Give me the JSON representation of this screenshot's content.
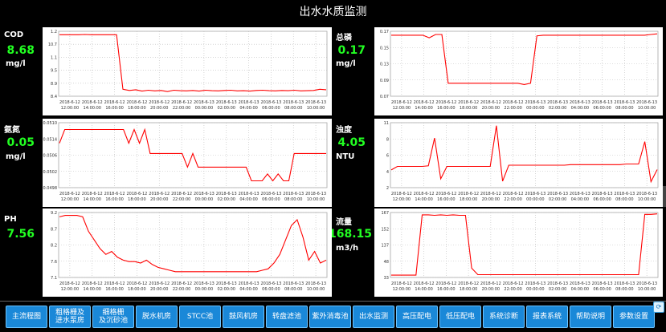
{
  "page": {
    "title": "出水水质监测"
  },
  "params": [
    {
      "name": "COD",
      "value": "8.68",
      "unit": "mg/l"
    },
    {
      "name": "总磷",
      "value": "0.17",
      "unit": "mg/l"
    },
    {
      "name": "氨氮",
      "value": "0.05",
      "unit": "mg/l"
    },
    {
      "name": "浊度",
      "value": "4.05",
      "unit": "NTU"
    },
    {
      "name": "PH",
      "value": "7.56",
      "unit": ""
    },
    {
      "name": "流量",
      "value": "168.15",
      "unit": "m3/h"
    }
  ],
  "nav": {
    "buttons": [
      "主流程图",
      "粗格栅及\n进水泵房",
      "细格栅\n及沉砂池",
      "脱水机房",
      "STCC池",
      "鼓风机房",
      "转盘滤池",
      "紫外消毒池",
      "出水监测",
      "高压配电",
      "低压配电",
      "系统诊断",
      "报表系统",
      "帮助说明",
      "参数设置"
    ]
  },
  "chart_data": [
    {
      "type": "line",
      "title": "COD",
      "color": "#ff0000",
      "x": [
        "2018-6-12 12:00:00",
        "2018-6-12 14:00:00",
        "2018-6-12 16:00:00",
        "2018-6-12 18:00:00",
        "2018-6-12 20:00:00",
        "2018-6-12 22:00:00",
        "2018-6-13 00:00:00",
        "2018-6-13 02:00:00",
        "2018-6-13 04:00:00",
        "2018-6-13 06:00:00",
        "2018-6-13 08:00:00",
        "2018-6-13 10:00:00"
      ],
      "yticks": [
        "1.2",
        "10.7",
        "1.1",
        "9.5",
        "8.9",
        "8.4"
      ],
      "ylim": [
        8.4,
        11.2
      ],
      "series": [
        {
          "values": [
            11.05,
            11.05,
            11.05,
            11.05,
            11.06,
            11.05,
            11.05,
            11.05,
            11.05,
            11.05,
            8.7,
            8.65,
            8.68,
            8.62,
            8.66,
            8.63,
            8.65,
            8.6,
            8.66,
            8.64,
            8.63,
            8.65,
            8.62,
            8.66,
            8.64,
            8.63,
            8.65,
            8.66,
            8.63,
            8.64,
            8.62,
            8.65,
            8.66,
            8.64,
            8.63,
            8.65,
            8.64,
            8.66,
            8.63,
            8.64,
            8.65,
            8.7,
            8.68
          ]
        }
      ]
    },
    {
      "type": "line",
      "title": "总磷",
      "color": "#ff0000",
      "x": [
        "2018-6-12 12:00:00",
        "2018-6-12 14:00:00",
        "2018-6-12 16:00:00",
        "2018-6-12 18:00:00",
        "2018-6-12 20:00:00",
        "2018-6-12 22:00:00",
        "2018-6-13 00:00:00",
        "2018-6-13 02:00:00",
        "2018-6-13 04:00:00",
        "2018-6-13 06:00:00",
        "2018-6-13 08:00:00",
        "2018-6-13 10:00:00"
      ],
      "yticks": [
        "0.17",
        "0.15",
        "0.13",
        "0.09",
        "0.07"
      ],
      "ylim": [
        0.07,
        0.17
      ],
      "series": [
        {
          "values": [
            0.164,
            0.164,
            0.164,
            0.164,
            0.164,
            0.164,
            0.16,
            0.165,
            0.165,
            0.09,
            0.09,
            0.09,
            0.09,
            0.09,
            0.09,
            0.09,
            0.09,
            0.09,
            0.09,
            0.09,
            0.09,
            0.088,
            0.09,
            0.163,
            0.164,
            0.164,
            0.164,
            0.164,
            0.164,
            0.164,
            0.164,
            0.164,
            0.164,
            0.164,
            0.164,
            0.164,
            0.164,
            0.164,
            0.164,
            0.164,
            0.164,
            0.165,
            0.166
          ]
        }
      ]
    },
    {
      "type": "line",
      "title": "氨氮",
      "color": "#ff0000",
      "x": [
        "2018-6-12 12:00:00",
        "2018-6-12 14:00:00",
        "2018-6-12 16:00:00",
        "2018-6-12 18:00:00",
        "2018-6-12 20:00:00",
        "2018-6-12 22:00:00",
        "2018-6-13 00:00:00",
        "2018-6-13 02:00:00",
        "2018-6-13 04:00:00",
        "2018-6-13 06:00:00",
        "2018-6-13 08:00:00",
        "2018-6-13 10:00:00"
      ],
      "yticks": [
        "0.0510",
        "0.0514",
        "0.0506",
        "0.0502",
        "0.0498"
      ],
      "ylim": [
        0.0497,
        0.0516
      ],
      "series": [
        {
          "values": [
            0.051,
            0.0514,
            0.0514,
            0.0514,
            0.0514,
            0.0514,
            0.0514,
            0.0514,
            0.0514,
            0.0514,
            0.0514,
            0.0514,
            0.0514,
            0.051,
            0.0514,
            0.051,
            0.0514,
            0.0507,
            0.0507,
            0.0507,
            0.0507,
            0.0507,
            0.0507,
            0.0507,
            0.0503,
            0.0507,
            0.0503,
            0.0503,
            0.0503,
            0.0503,
            0.0503,
            0.0503,
            0.0503,
            0.0503,
            0.0503,
            0.0503,
            0.0499,
            0.0499,
            0.0499,
            0.0501,
            0.0499,
            0.0501,
            0.0499,
            0.0499,
            0.0507,
            0.0507,
            0.0507,
            0.0507,
            0.0507,
            0.0507,
            0.0507
          ]
        }
      ]
    },
    {
      "type": "line",
      "title": "浊度",
      "color": "#ff0000",
      "x": [
        "2018-6-12 12:00:00",
        "2018-6-12 14:00:00",
        "2018-6-12 16:00:00",
        "2018-6-12 18:00:00",
        "2018-6-12 20:00:00",
        "2018-6-12 22:00:00",
        "2018-6-13 00:00:00",
        "2018-6-13 02:00:00",
        "2018-6-13 04:00:00",
        "2018-6-13 06:00:00",
        "2018-6-13 08:00:00",
        "2018-6-13 10:00:00"
      ],
      "yticks": [
        "11",
        "8",
        "6",
        "4",
        "2"
      ],
      "ylim": [
        1,
        12
      ],
      "series": [
        {
          "values": [
            4,
            4.6,
            4.6,
            4.6,
            4.6,
            4.6,
            4.7,
            9.4,
            2.5,
            4.6,
            4.6,
            4.6,
            4.6,
            4.6,
            4.6,
            4.6,
            4.6,
            11.5,
            2.1,
            4.8,
            4.8,
            4.8,
            4.8,
            4.8,
            4.8,
            4.8,
            4.8,
            4.8,
            4.8,
            4.9,
            4.9,
            4.9,
            4.9,
            4.9,
            4.9,
            4.9,
            4.9,
            4.9,
            5,
            5,
            5,
            8.8,
            2,
            4.05
          ]
        }
      ]
    },
    {
      "type": "line",
      "title": "PH",
      "color": "#ff0000",
      "x": [
        "2018-6-12 12:00:00",
        "2018-6-12 14:00:00",
        "2018-6-12 16:00:00",
        "2018-6-12 18:00:00",
        "2018-6-12 20:00:00",
        "2018-6-12 22:00:00",
        "2018-6-13 00:00:00",
        "2018-6-13 02:00:00",
        "2018-6-13 04:00:00",
        "2018-6-13 06:00:00",
        "2018-6-13 08:00:00",
        "2018-6-13 10:00:00"
      ],
      "yticks": [
        "9.2",
        "8.7",
        "8.2",
        "7.6",
        "7.1"
      ],
      "ylim": [
        7.0,
        9.25
      ],
      "series": [
        {
          "values": [
            9.1,
            9.15,
            9.15,
            9.15,
            9.1,
            8.6,
            8.3,
            8.0,
            7.8,
            7.9,
            7.7,
            7.6,
            7.55,
            7.55,
            7.5,
            7.6,
            7.45,
            7.35,
            7.3,
            7.25,
            7.2,
            7.2,
            7.2,
            7.2,
            7.2,
            7.2,
            7.2,
            7.2,
            7.2,
            7.2,
            7.2,
            7.2,
            7.2,
            7.2,
            7.2,
            7.25,
            7.3,
            7.5,
            7.8,
            8.3,
            8.8,
            9.0,
            8.4,
            7.6,
            7.9,
            7.5,
            7.6
          ]
        }
      ]
    },
    {
      "type": "line",
      "title": "流量",
      "color": "#ff0000",
      "x": [
        "2018-6-12 12:00:00",
        "2018-6-12 14:00:00",
        "2018-6-12 16:00:00",
        "2018-6-12 18:00:00",
        "2018-6-12 20:00:00",
        "2018-6-12 22:00:00",
        "2018-6-13 00:00:00",
        "2018-6-13 02:00:00",
        "2018-6-13 04:00:00",
        "2018-6-13 06:00:00",
        "2018-6-13 08:00:00",
        "2018-6-13 10:00:00"
      ],
      "yticks": [
        "167",
        "152",
        "137",
        "48",
        "33"
      ],
      "ylim": [
        30,
        170
      ],
      "series": [
        {
          "values": [
            35,
            35,
            35,
            35,
            35,
            165,
            165,
            164,
            165,
            164,
            165,
            164,
            164,
            50,
            36,
            36,
            36,
            36,
            36,
            36,
            36,
            36,
            36,
            36,
            36,
            36,
            36,
            36,
            36,
            36,
            36,
            36,
            36,
            36,
            36,
            36,
            36,
            36,
            36,
            36,
            36,
            166,
            166,
            167
          ]
        }
      ]
    }
  ]
}
